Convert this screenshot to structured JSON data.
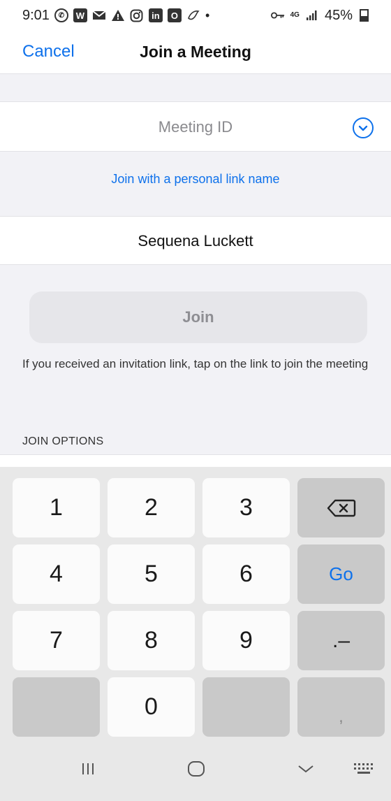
{
  "status_bar": {
    "time": "9:01",
    "battery": "45%",
    "network": "4G",
    "left_icons": [
      "whatsapp-icon",
      "app-w-icon",
      "mail-icon",
      "alert-icon",
      "instagram-icon",
      "linkedin-icon",
      "outlook-icon",
      "bird-icon",
      "dot-icon"
    ],
    "right_icons": [
      "vpn-key-icon",
      "network-4g-icon",
      "signal-icon",
      "battery-icon"
    ]
  },
  "header": {
    "cancel_label": "Cancel",
    "title": "Join a Meeting"
  },
  "meeting_id": {
    "placeholder": "Meeting ID",
    "value": ""
  },
  "personal_link_label": "Join with a personal link name",
  "name_field": {
    "value": "Sequena Luckett"
  },
  "join_button_label": "Join",
  "hint_text": "If you received an invitation link, tap on the link to join the meeting",
  "join_options_label": "JOIN OPTIONS",
  "keypad": {
    "k1": "1",
    "k2": "2",
    "k3": "3",
    "k4": "4",
    "k5": "5",
    "k6": "6",
    "k7": "7",
    "k8": "8",
    "k9": "9",
    "k0": "0",
    "go": "Go",
    "dot_dash": ".–",
    "comma": ","
  },
  "colors": {
    "accent": "#0e71eb",
    "background": "#f2f2f6",
    "keypad_background": "#e8e8e8"
  }
}
